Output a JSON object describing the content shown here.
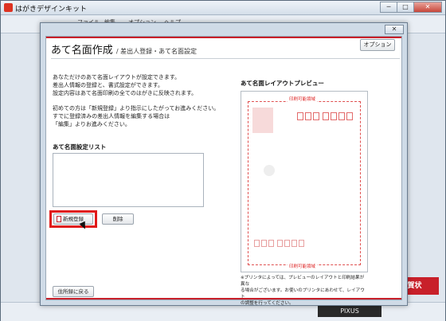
{
  "app": {
    "title": "はがきデザインキット",
    "toolbar": [
      "ファイル",
      "編集",
      "オプション",
      "ヘルプ"
    ],
    "close_glyph": "✕",
    "minimize_glyph": "─",
    "maximize_glyph": "□",
    "banner": "年賀状",
    "printer_brand": "PIXUS"
  },
  "dialog": {
    "close_glyph": "✕",
    "title_main": "あて名面作成",
    "title_sub": "/ 差出人登録・あて名面設定",
    "option_label": "オプション",
    "intro_lines": [
      "あなただけのあて名面レイアウトが設定できます。",
      "差出人情報の登録と、書式設定ができます。",
      "設定内容はあて名面印刷の全てのはがきに反映されます。"
    ],
    "intro2_lines": [
      "初めての方は「新規登録」より指示にしたがってお進みください。",
      "すでに登録済みの差出人情報を編集する場合は",
      "「編集」よりお進みください。"
    ],
    "list_label": "あて名面設定リスト",
    "new_label": "新規登録",
    "delete_label": "削除",
    "back_label": "住所録に戻る",
    "preview_label": "あて名面レイアウトプレビュー",
    "print_area_label": "印刷可能領域",
    "note_lines": [
      "※プリンタによっては、プレビューのレイアウトと印刷結果が異な",
      "る場合がございます。お使いのプリンタにあわせて、レイアウト",
      "の調整を行ってください。"
    ]
  }
}
